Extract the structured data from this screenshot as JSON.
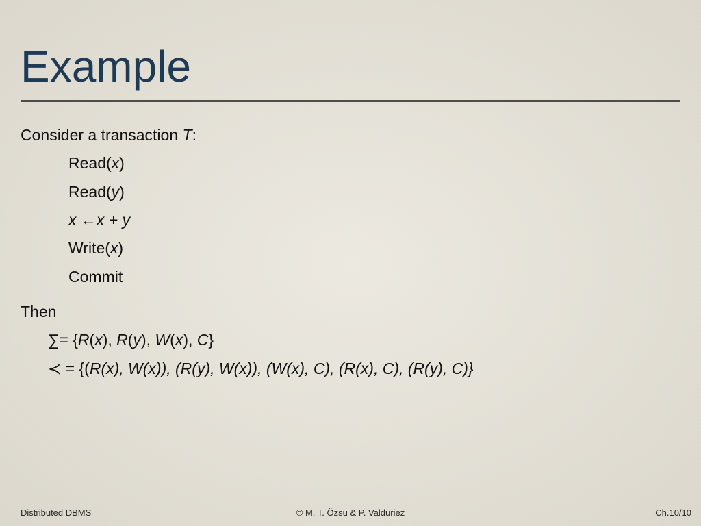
{
  "title": "Example",
  "intro_prefix": "Consider a transaction ",
  "intro_T": "T",
  "intro_suffix": ":",
  "ops": {
    "read_x_a": "Read(",
    "read_x_b": "x",
    "read_x_c": ")",
    "read_y_a": "Read(",
    "read_y_b": "y",
    "read_y_c": ")",
    "assign_a": "x ",
    "assign_arrow": "←",
    "assign_b": "x + y",
    "write_x_a": "Write(",
    "write_x_b": "x",
    "write_x_c": ")",
    "commit": "Commit"
  },
  "then": "Then",
  "sigma": {
    "sym": "∑",
    "eq": "= {",
    "r1a": "R",
    "r1b": "(",
    "r1c": "x",
    "r1d": "), ",
    "r2a": "R",
    "r2b": "(",
    "r2c": "y",
    "r2d": "), ",
    "w1a": "W",
    "w1b": "(",
    "w1c": "x",
    "w1d": "), ",
    "c": "C",
    "close": "}"
  },
  "prec": {
    "sym": "≺",
    "eq": " = {(",
    "p1": "R(x), W(x)), (R(y), W(x)), (W(x), C), (R(x), C), (R(y), C)}"
  },
  "footer": {
    "left": "Distributed DBMS",
    "center": "© M. T. Özsu & P. Valduriez",
    "right": "Ch.10/10"
  }
}
